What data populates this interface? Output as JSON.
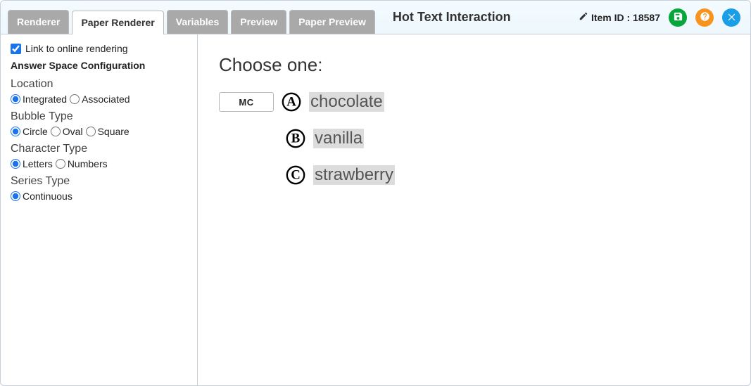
{
  "header": {
    "tabs": [
      "Renderer",
      "Paper Renderer",
      "Variables",
      "Preview",
      "Paper Preview"
    ],
    "active_tab_index": 1,
    "title": "Hot Text Interaction",
    "item_id_label": "Item ID : 18587"
  },
  "sidebar": {
    "link_online_label": "Link to online rendering",
    "link_online_checked": true,
    "config_title": "Answer Space Configuration",
    "location": {
      "label": "Location",
      "options": [
        "Integrated",
        "Associated"
      ],
      "selected_index": 0
    },
    "bubble_type": {
      "label": "Bubble Type",
      "options": [
        "Circle",
        "Oval",
        "Square"
      ],
      "selected_index": 0
    },
    "character_type": {
      "label": "Character Type",
      "options": [
        "Letters",
        "Numbers"
      ],
      "selected_index": 0
    },
    "series_type": {
      "label": "Series Type",
      "options": [
        "Continuous"
      ],
      "selected_index": 0
    }
  },
  "content": {
    "prompt": "Choose one:",
    "mc_label": "MC",
    "choices": [
      {
        "letter": "A",
        "text": "chocolate"
      },
      {
        "letter": "B",
        "text": "vanilla"
      },
      {
        "letter": "C",
        "text": "strawberry"
      }
    ]
  }
}
